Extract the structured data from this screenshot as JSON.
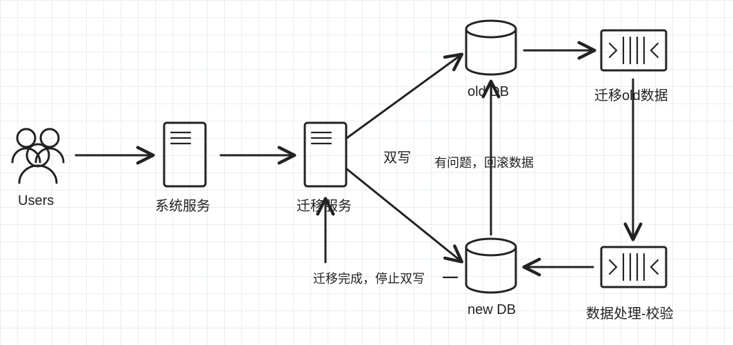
{
  "nodes": {
    "users": {
      "label": "Users"
    },
    "system_service": {
      "label": "系统服务"
    },
    "migration_service": {
      "label": "迁移服务"
    },
    "old_db": {
      "label": "old  DB"
    },
    "new_db": {
      "label": "new DB"
    },
    "migrate_old_data": {
      "label": "迁移old数据"
    },
    "data_processing_verify": {
      "label": "数据处理-校验"
    }
  },
  "edges": {
    "dual_write": "双写",
    "rollback_if_problem": "有问题，回滚数据",
    "migration_done_stop": "迁移完成，停止双写"
  }
}
